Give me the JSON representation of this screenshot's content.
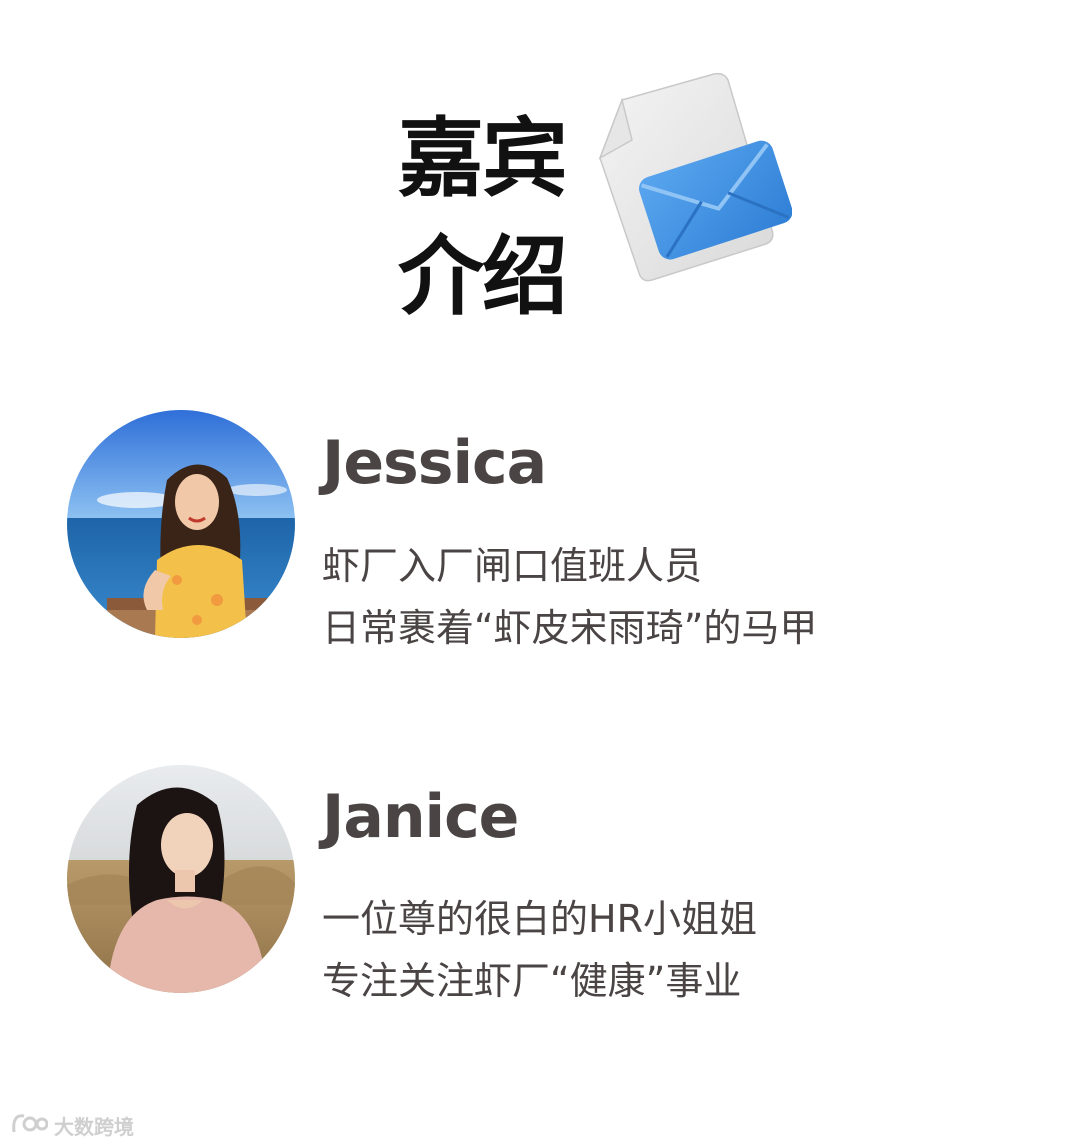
{
  "header": {
    "title_line1": "嘉宾",
    "title_line2": "介绍",
    "illustration_icon": "document-envelope-icon"
  },
  "guests": [
    {
      "name": "Jessica",
      "line1": "虾厂入厂闸口值班人员",
      "line2": "日常裹着“虾皮宋雨琦”的马甲",
      "avatar_icon": "woman-by-sea-avatar"
    },
    {
      "name": "Janice",
      "line1": "一位尊的很白的HR小姐姐",
      "line2": "专注关注虾厂“健康”事业",
      "avatar_icon": "woman-in-field-avatar"
    }
  ],
  "watermark": {
    "text": "大数跨境",
    "logo_icon": "dashu-logo-icon"
  },
  "colors": {
    "title": "#111111",
    "body_text": "#4a4444",
    "envelope_blue": "#3f8fe0",
    "watermark": "#cfcfcf"
  }
}
